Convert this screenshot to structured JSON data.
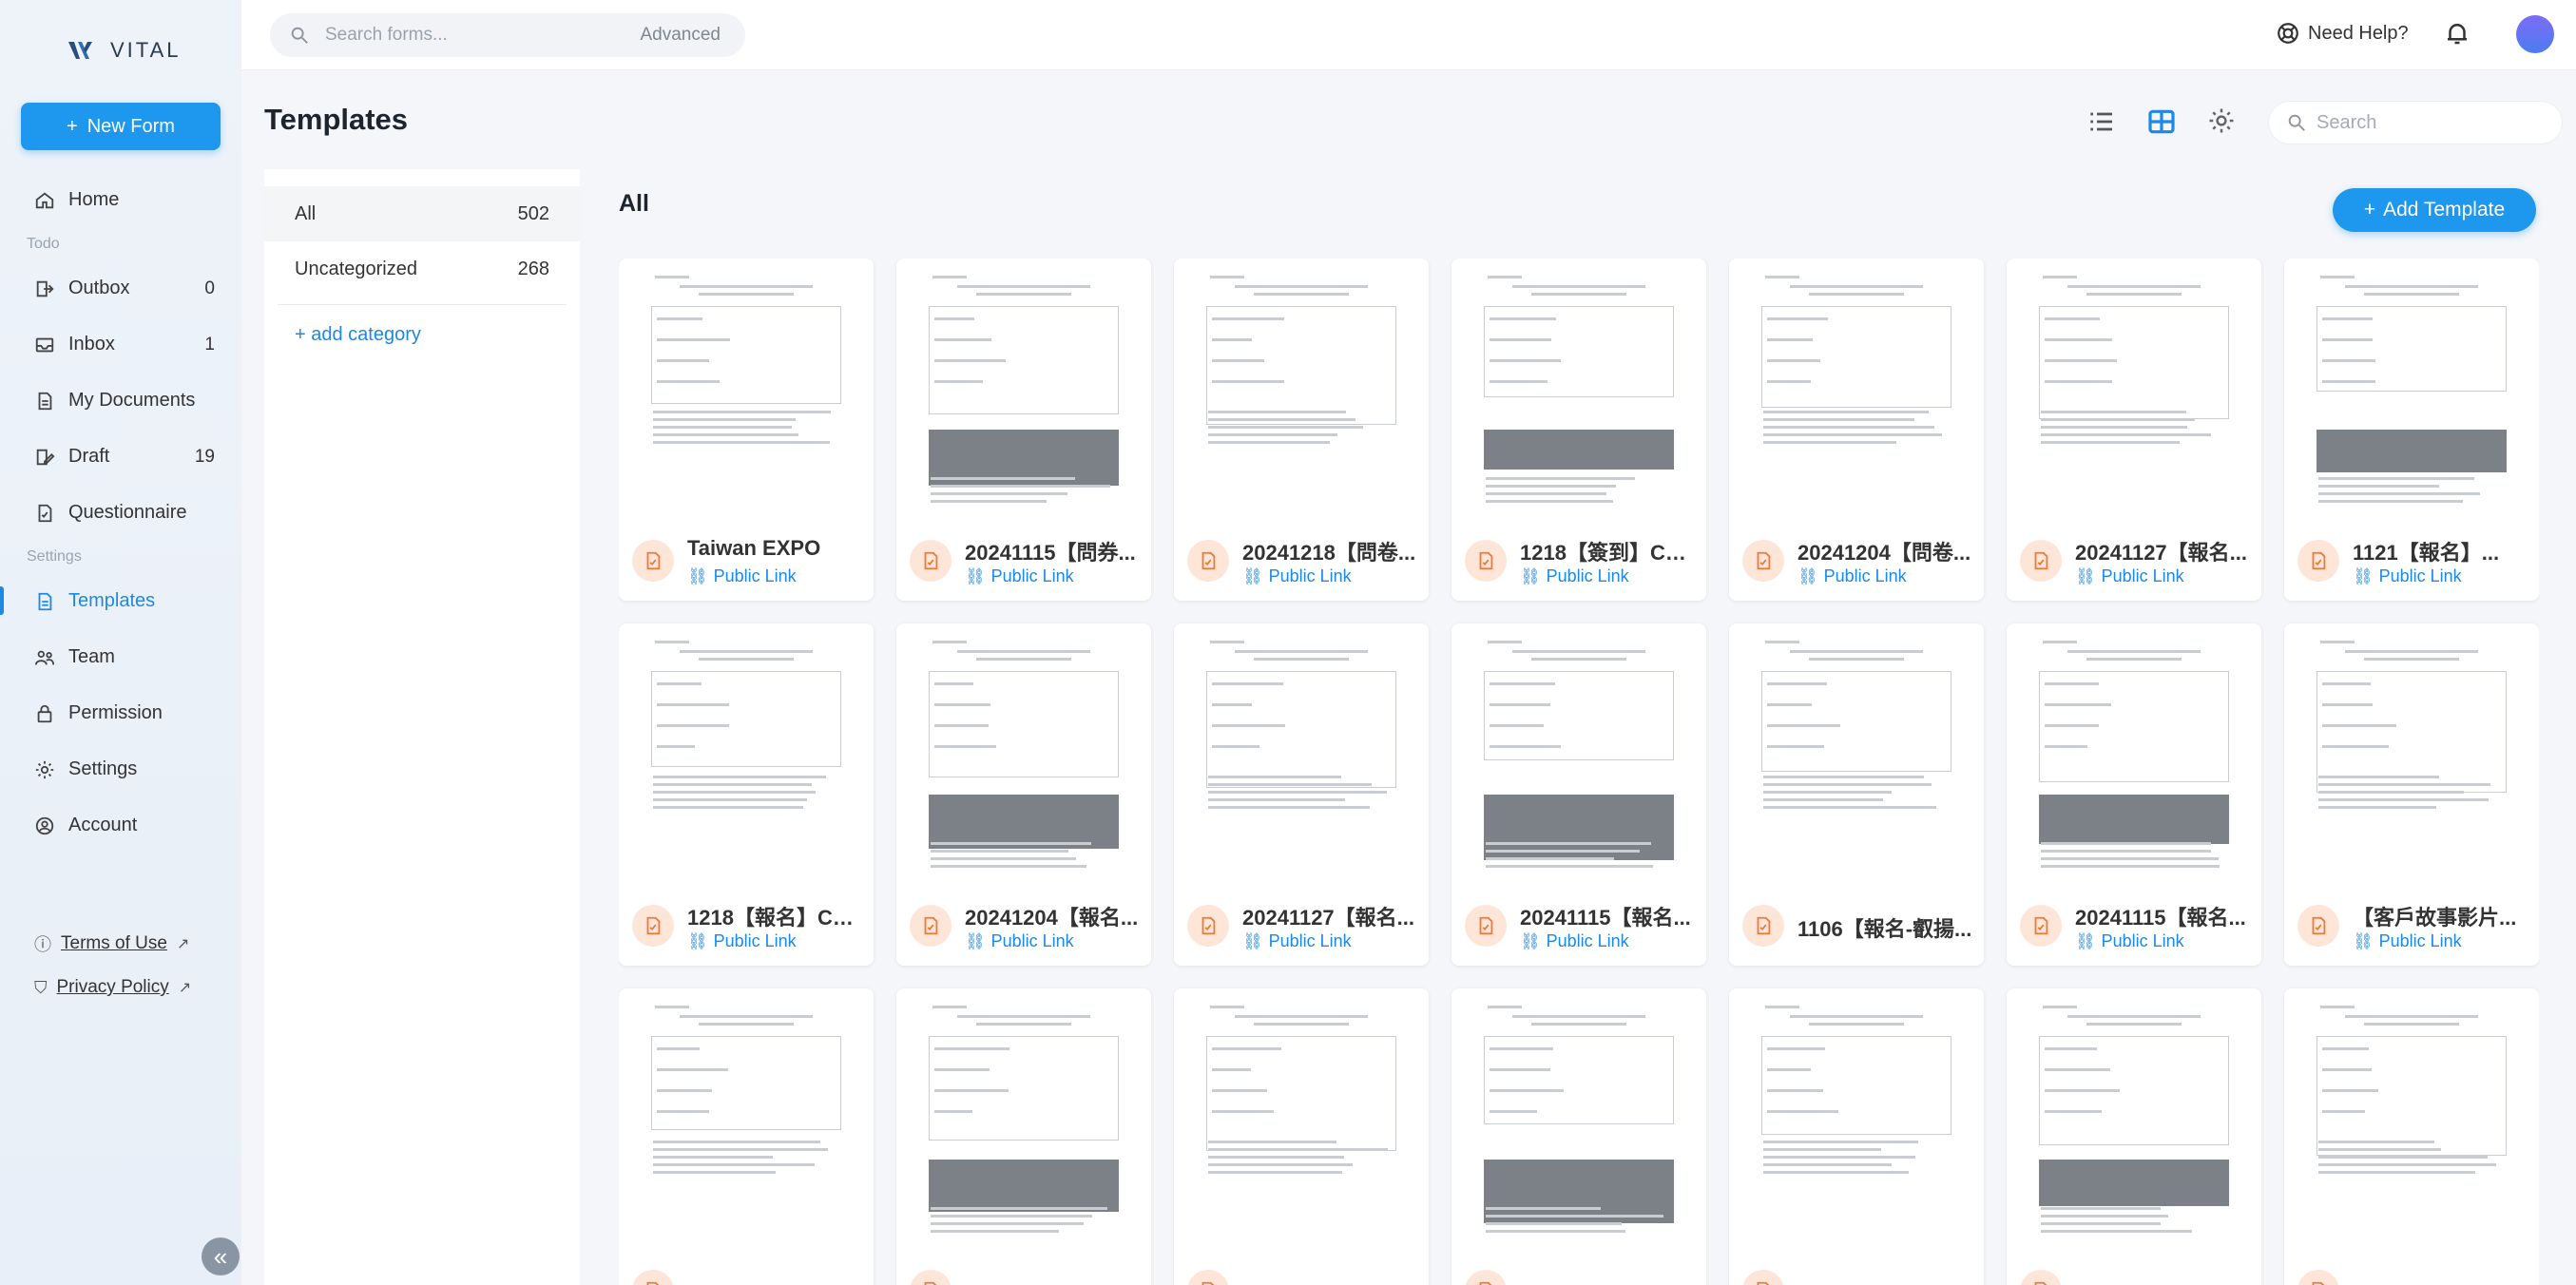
{
  "app": {
    "name": "VITAL"
  },
  "sidebar": {
    "new_form": "New Form",
    "home": "Home",
    "todo_header": "Todo",
    "items": [
      {
        "label": "Outbox",
        "count": "0"
      },
      {
        "label": "Inbox",
        "count": "1"
      },
      {
        "label": "My Documents",
        "count": ""
      },
      {
        "label": "Draft",
        "count": "19"
      },
      {
        "label": "Questionnaire",
        "count": ""
      }
    ],
    "settings_header": "Settings",
    "settings_items": [
      {
        "label": "Templates"
      },
      {
        "label": "Team"
      },
      {
        "label": "Permission"
      },
      {
        "label": "Settings"
      },
      {
        "label": "Account"
      }
    ],
    "terms": "Terms of Use",
    "privacy": "Privacy Policy"
  },
  "topbar": {
    "search_placeholder": "Search forms...",
    "advanced": "Advanced",
    "need_help": "Need Help?"
  },
  "page": {
    "title": "Templates",
    "search_placeholder": "Search",
    "all_heading": "All",
    "add_template": "Add Template"
  },
  "categories": [
    {
      "name": "All",
      "count": "502"
    },
    {
      "name": "Uncategorized",
      "count": "268"
    }
  ],
  "add_category": "add category",
  "public_link": "Public Link",
  "templates": [
    {
      "title": "Taiwan EXPO",
      "public": true
    },
    {
      "title": "20241115【問券...",
      "public": true
    },
    {
      "title": "20241218【問卷...",
      "public": true
    },
    {
      "title": "1218【簽到】CR...",
      "public": true
    },
    {
      "title": "20241204【問卷...",
      "public": true
    },
    {
      "title": "20241127【報名...",
      "public": true
    },
    {
      "title": "1121【報名】...",
      "public": true
    },
    {
      "title": "1218【報名】CR...",
      "public": true
    },
    {
      "title": "20241204【報名...",
      "public": true
    },
    {
      "title": "20241127【報名...",
      "public": true
    },
    {
      "title": "20241115【報名...",
      "public": true
    },
    {
      "title": "1106【報名-叡揚...",
      "public": false
    },
    {
      "title": "20241115【報名...",
      "public": true
    },
    {
      "title": "【客戶故事影片...",
      "public": true
    },
    {
      "title": "",
      "public": false
    },
    {
      "title": "",
      "public": false
    },
    {
      "title": "",
      "public": false
    },
    {
      "title": "",
      "public": false
    },
    {
      "title": "",
      "public": false
    },
    {
      "title": "",
      "public": false
    },
    {
      "title": "",
      "public": false
    }
  ],
  "colors": {
    "accent": "#1e97ee",
    "link": "#1e88e5",
    "doc_icon_bg": "#fde6d8",
    "doc_icon": "#f07a3a"
  }
}
